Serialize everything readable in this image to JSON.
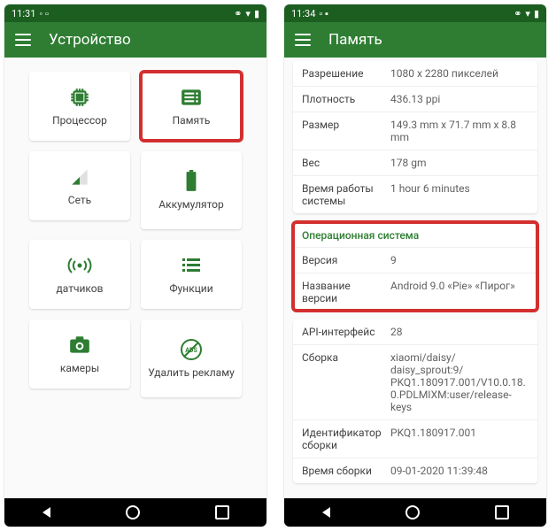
{
  "left": {
    "statusTime": "11:31",
    "title": "Устройство",
    "cards": [
      {
        "name": "cpu",
        "label": "Процессор",
        "icon": "cpu"
      },
      {
        "name": "memory",
        "label": "Память",
        "icon": "memory",
        "highlighted": true
      },
      {
        "name": "network",
        "label": "Сеть",
        "icon": "signal"
      },
      {
        "name": "battery",
        "label": "Аккумулятор",
        "icon": "battery"
      },
      {
        "name": "sensors",
        "label": "датчиков",
        "icon": "sensor"
      },
      {
        "name": "functions",
        "label": "Функции",
        "icon": "list"
      },
      {
        "name": "cameras",
        "label": "камеры",
        "icon": "camera"
      },
      {
        "name": "noads",
        "label": "Удалить рекламу",
        "icon": "noads"
      }
    ]
  },
  "right": {
    "statusTime": "11:34",
    "title": "Память",
    "display": {
      "rows": [
        {
          "key": "Разрешение",
          "val": "1080 x 2280 пикселей"
        },
        {
          "key": "Плотность",
          "val": "436.13 ppi"
        },
        {
          "key": "Размер",
          "val": "149.3 mm x 71.7 mm x 8.8 mm"
        },
        {
          "key": "Вес",
          "val": "178 gm"
        },
        {
          "key": "Время работы системы",
          "val": "1 hour 6 minutes"
        }
      ]
    },
    "os": {
      "title": "Операционная система",
      "rows": [
        {
          "key": "Версия",
          "val": "9"
        },
        {
          "key": "Название версии",
          "val": "Android 9.0 «Pie» «Пирог»"
        }
      ]
    },
    "os2": {
      "rows": [
        {
          "key": "API-интерфейс",
          "val": "28"
        },
        {
          "key": "Сборка",
          "val": "xiaomi/daisy/ daisy_sprout:9/ PKQ1.180917.001/V10.0.18.0.PDLMIXM:user/release-keys"
        },
        {
          "key": "Идентификатор сборки",
          "val": "PKQ1.180917.001"
        },
        {
          "key": "Время сборки",
          "val": "09-01-2020 11:39:48"
        }
      ]
    }
  }
}
